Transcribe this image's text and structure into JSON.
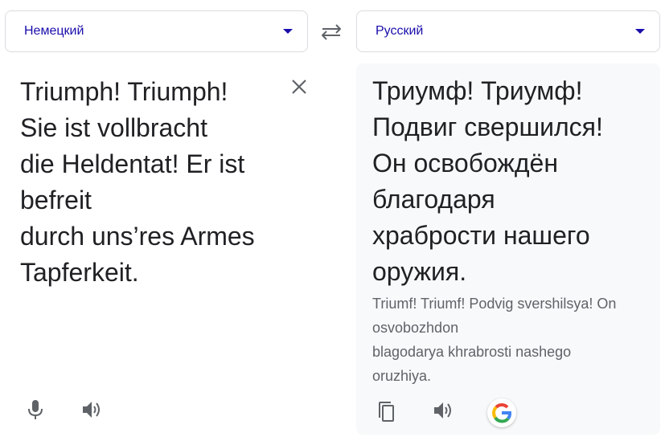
{
  "source": {
    "language": "Немецкий",
    "text": "Triumph! Triumph!\nSie ist vollbracht\ndie Heldentat! Er ist\nbefreit\ndurch uns’res Armes\nTapferkeit."
  },
  "target": {
    "language": "Русский",
    "text": "Триумф! Триумф!\nПодвиг свершился!\nОн освобождён\nблагодаря\nхрабрости нашего\nоружия.",
    "transliteration": "Triumf! Triumf! Podvig svershilsya! On\nosvobozhdon\nblagodarya khrabrosti nashego\noruzhiya."
  },
  "icons": {
    "swap": "swap-languages-icon",
    "clear": "close-icon",
    "mic": "microphone-icon",
    "listen": "speaker-icon",
    "copy": "copy-icon",
    "google": "google-logo-icon"
  },
  "colors": {
    "accent": "#1a0dab",
    "icon": "#5f6368",
    "text": "#202124",
    "panel": "#f8f9fa"
  }
}
